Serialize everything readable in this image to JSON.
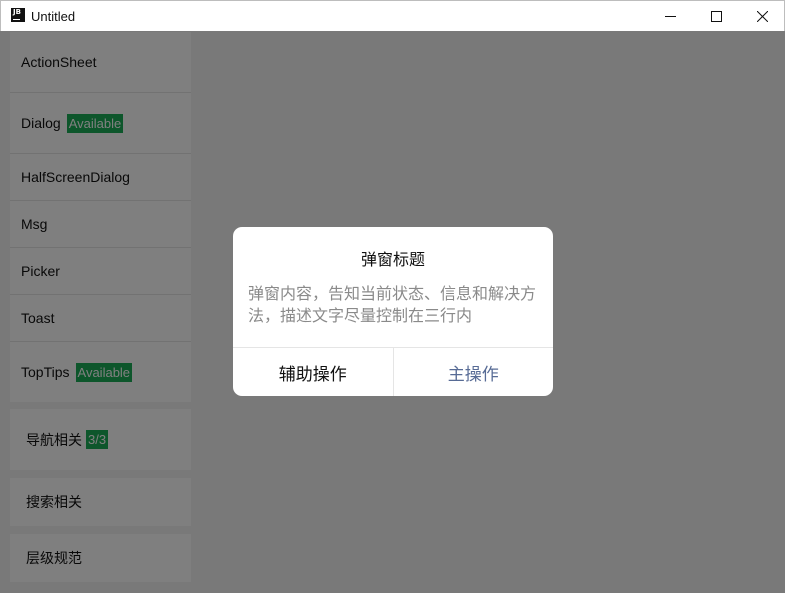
{
  "window": {
    "title": "Untitled",
    "icon_label": "JB",
    "controls": {
      "minimize_icon": "minimize-icon",
      "maximize_icon": "maximize-icon",
      "close_icon": "close-icon"
    }
  },
  "sidebar": {
    "items": [
      {
        "label": "ActionSheet",
        "badge": ""
      },
      {
        "label": "Dialog",
        "badge": "Available"
      },
      {
        "label": "HalfScreenDialog",
        "badge": ""
      },
      {
        "label": "Msg",
        "badge": ""
      },
      {
        "label": "Picker",
        "badge": ""
      },
      {
        "label": "Toast",
        "badge": ""
      },
      {
        "label": "TopTips",
        "badge": "Available"
      }
    ],
    "groups": [
      {
        "label": "导航相关",
        "badge": "3/3"
      },
      {
        "label": "搜索相关"
      },
      {
        "label": "层级规范"
      }
    ]
  },
  "dialog": {
    "title": "弹窗标题",
    "body": "弹窗内容，告知当前状态、信息和解决方法，描述文字尽量控制在三行内",
    "secondary_label": "辅助操作",
    "primary_label": "主操作"
  },
  "colors": {
    "badge": "#1aad57",
    "primary_action": "#576b95",
    "mask": "rgba(0,0,0,0.5)"
  }
}
